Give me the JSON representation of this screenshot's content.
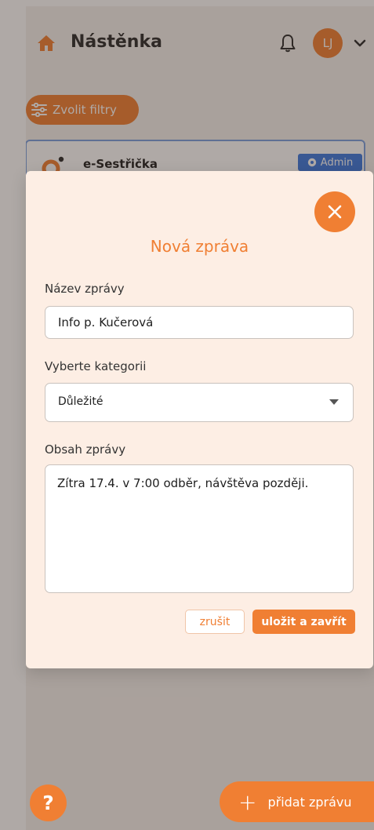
{
  "header": {
    "title": "Nástěnka",
    "avatar_initials": "LJ",
    "home_icon": "home-icon",
    "notification_icon": "bell-icon",
    "menu_icon": "chevron-down-icon"
  },
  "filters": {
    "label": "Zvolit filtry",
    "icon": "sliders-icon"
  },
  "card": {
    "author": "e-Sestřička",
    "badge": "Admin"
  },
  "modal": {
    "title": "Nová zpráva",
    "name_label": "Název zprávy",
    "name_value": "Info p. Kučerová",
    "category_label": "Vyberte kategorii",
    "category_value": "Důležité",
    "content_label": "Obsah zprávy",
    "content_value": "Zítra 17.4. v 7:00 odběr, návštěva později.",
    "cancel_label": "zrušit",
    "save_label": "uložit a zavřít",
    "close_icon": "close-icon"
  },
  "footer": {
    "help_label": "?",
    "add_label": "přidat zprávu",
    "add_icon": "plus-icon"
  },
  "colors": {
    "accent": "#f07f33",
    "modal_bg": "#fdeee4",
    "badge": "#3b78e0",
    "card_border": "#7aa0e0"
  }
}
